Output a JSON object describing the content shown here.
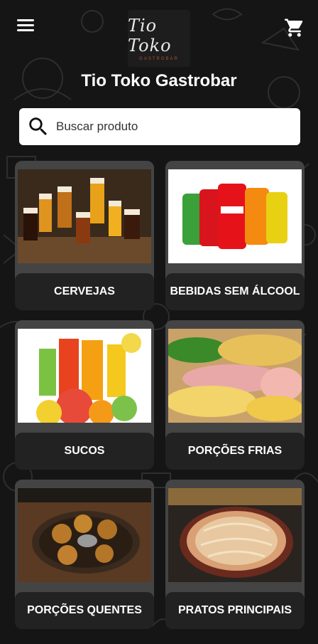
{
  "header": {
    "logo_text": "Tio Toko",
    "logo_subtext": "GASTROBAR",
    "title": "Tio Toko Gastrobar"
  },
  "search": {
    "placeholder": "Buscar produto",
    "value": ""
  },
  "categories": [
    {
      "label": "CERVEJAS"
    },
    {
      "label": "BEBIDAS SEM ÁLCOOL"
    },
    {
      "label": "SUCOS"
    },
    {
      "label": "PORÇÕES FRIAS"
    },
    {
      "label": "PORÇÕES QUENTES"
    },
    {
      "label": "PRATOS PRINCIPAIS"
    }
  ],
  "icons": {
    "menu": "menu-icon",
    "cart": "cart-icon",
    "search": "search-icon"
  },
  "colors": {
    "background": "#151515",
    "card": "#444444",
    "card_label": "#222222",
    "search_bg": "#ffffff"
  }
}
